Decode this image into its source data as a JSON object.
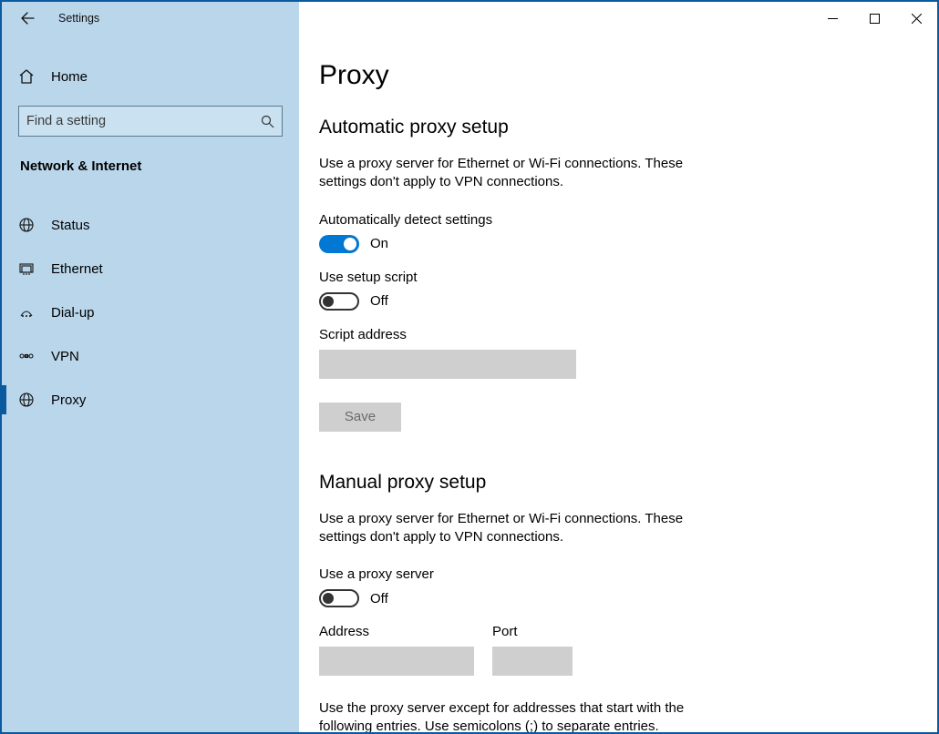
{
  "window": {
    "title": "Settings"
  },
  "sidebar": {
    "home_label": "Home",
    "search_placeholder": "Find a setting",
    "category": "Network & Internet",
    "items": [
      {
        "id": "status",
        "label": "Status",
        "icon": "globe-icon"
      },
      {
        "id": "ethernet",
        "label": "Ethernet",
        "icon": "ethernet-icon"
      },
      {
        "id": "dialup",
        "label": "Dial-up",
        "icon": "dialup-icon"
      },
      {
        "id": "vpn",
        "label": "VPN",
        "icon": "vpn-icon"
      },
      {
        "id": "proxy",
        "label": "Proxy",
        "icon": "globe-icon",
        "active": true
      }
    ]
  },
  "content": {
    "page_title": "Proxy",
    "auto": {
      "heading": "Automatic proxy setup",
      "description": "Use a proxy server for Ethernet or Wi-Fi connections. These settings don't apply to VPN connections.",
      "detect_label": "Automatically detect settings",
      "detect_state_label": "On",
      "detect_on": true,
      "script_toggle_label": "Use setup script",
      "script_state_label": "Off",
      "script_on": false,
      "script_address_label": "Script address",
      "script_address_value": "",
      "save_label": "Save"
    },
    "manual": {
      "heading": "Manual proxy setup",
      "description": "Use a proxy server for Ethernet or Wi-Fi connections. These settings don't apply to VPN connections.",
      "proxy_toggle_label": "Use a proxy server",
      "proxy_state_label": "Off",
      "proxy_on": false,
      "address_label": "Address",
      "address_value": "",
      "port_label": "Port",
      "port_value": "",
      "exceptions_label": "Use the proxy server except for addresses that start with the following entries. Use semicolons (;) to separate entries."
    }
  }
}
